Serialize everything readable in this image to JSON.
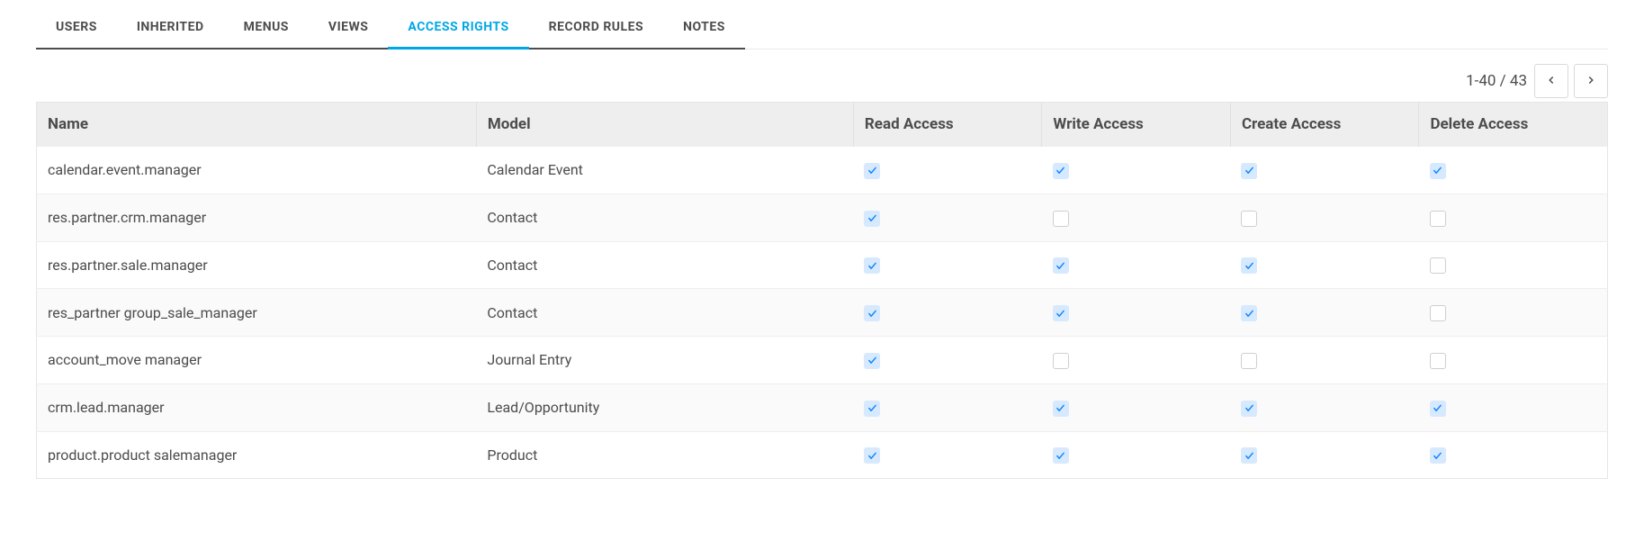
{
  "tabs": [
    {
      "label": "USERS",
      "active": false
    },
    {
      "label": "INHERITED",
      "active": false
    },
    {
      "label": "MENUS",
      "active": false
    },
    {
      "label": "VIEWS",
      "active": false
    },
    {
      "label": "ACCESS RIGHTS",
      "active": true
    },
    {
      "label": "RECORD RULES",
      "active": false
    },
    {
      "label": "NOTES",
      "active": false
    }
  ],
  "pager": {
    "text": "1-40 / 43"
  },
  "table": {
    "headers": {
      "name": "Name",
      "model": "Model",
      "read": "Read Access",
      "write": "Write Access",
      "create": "Create Access",
      "delete": "Delete Access"
    },
    "rows": [
      {
        "name": "calendar.event.manager",
        "model": "Calendar Event",
        "read": true,
        "write": true,
        "create": true,
        "delete": true
      },
      {
        "name": "res.partner.crm.manager",
        "model": "Contact",
        "read": true,
        "write": false,
        "create": false,
        "delete": false
      },
      {
        "name": "res.partner.sale.manager",
        "model": "Contact",
        "read": true,
        "write": true,
        "create": true,
        "delete": false
      },
      {
        "name": "res_partner group_sale_manager",
        "model": "Contact",
        "read": true,
        "write": true,
        "create": true,
        "delete": false
      },
      {
        "name": "account_move manager",
        "model": "Journal Entry",
        "read": true,
        "write": false,
        "create": false,
        "delete": false
      },
      {
        "name": "crm.lead.manager",
        "model": "Lead/Opportunity",
        "read": true,
        "write": true,
        "create": true,
        "delete": true
      },
      {
        "name": "product.product salemanager",
        "model": "Product",
        "read": true,
        "write": true,
        "create": true,
        "delete": true
      }
    ]
  }
}
